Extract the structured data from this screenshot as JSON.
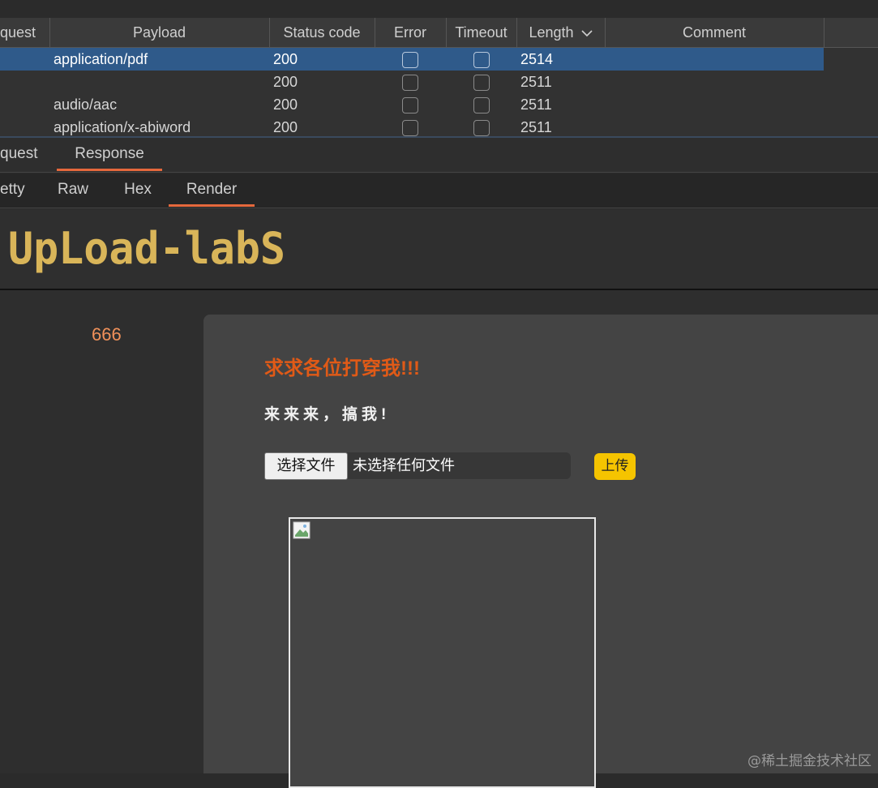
{
  "results_table": {
    "columns": [
      "quest",
      "Payload",
      "Status code",
      "Error",
      "Timeout",
      "Length",
      "Comment"
    ],
    "rows": [
      {
        "payload": "application/pdf",
        "status": "200",
        "length": "2514",
        "selected": true
      },
      {
        "payload": "",
        "status": "200",
        "length": "2511",
        "selected": false
      },
      {
        "payload": "audio/aac",
        "status": "200",
        "length": "2511",
        "selected": false
      },
      {
        "payload": "application/x-abiword",
        "status": "200",
        "length": "2511",
        "selected": false
      }
    ]
  },
  "message_tabs": {
    "request": "quest",
    "response": "Response"
  },
  "view_tabs": {
    "pretty": "etty",
    "raw": "Raw",
    "hex": "Hex",
    "render": "Render"
  },
  "render": {
    "logo_text": "UpLoad-labS",
    "side_number": "666",
    "heading": "求求各位打穿我!!!",
    "subtitle": "来来来，搞我!",
    "choose_file_label": "选择文件",
    "no_file_text": "未选择任何文件",
    "upload_label": "上传"
  },
  "watermark": "@稀土掘金技术社区",
  "colors": {
    "accent_orange": "#e5683c",
    "selected_row": "#2f5a8a",
    "logo_gold": "#d9b559",
    "heading_orange": "#e05a17",
    "upload_yellow": "#f5c400"
  }
}
